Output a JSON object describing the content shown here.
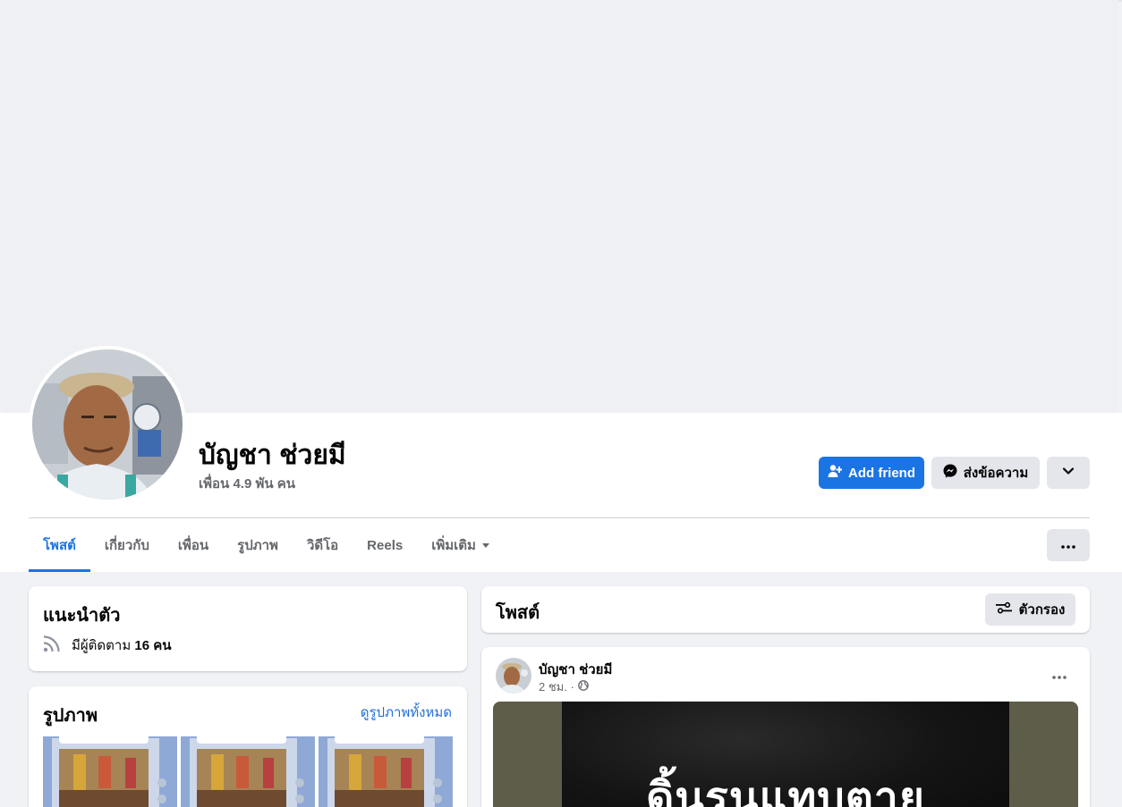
{
  "profile": {
    "name": "บัญชา ช่วยมี",
    "friends": "เพื่อน 4.9 พัน คน"
  },
  "actions": {
    "add_friend": "Add friend",
    "message": "ส่งข้อความ"
  },
  "tabs": [
    {
      "label": "โพสต์",
      "active": true
    },
    {
      "label": "เกี่ยวกับ",
      "active": false
    },
    {
      "label": "เพื่อน",
      "active": false
    },
    {
      "label": "รูปภาพ",
      "active": false
    },
    {
      "label": "วิดีโอ",
      "active": false
    },
    {
      "label": "Reels",
      "active": false
    },
    {
      "label": "เพิ่มเติม",
      "active": false
    }
  ],
  "intro": {
    "title": "แนะนำตัว",
    "followers_prefix": "มีผู้ติดตาม ",
    "followers_count": "16 คน"
  },
  "photos": {
    "title": "รูปภาพ",
    "see_all": "ดูรูปภาพทั้งหมด"
  },
  "posts": {
    "title": "โพสต์",
    "filter_label": "ตัวกรอง"
  },
  "post": {
    "author": "บัญชา ช่วยมี",
    "time": "2 ชม. ·",
    "media_caption": "ดิ้นรนแทบตาย"
  },
  "colors": {
    "accent": "#1b74e4",
    "link": "#216fdb",
    "secondary_button": "#e4e6eb",
    "page_background": "#f0f2f5"
  },
  "icons": {
    "add_friend": "person-plus-icon",
    "message": "messenger-icon",
    "dropdown": "chevron-down-icon",
    "more": "ellipsis-icon",
    "followers": "rss-icon",
    "filter": "sliders-icon",
    "privacy": "globe-icon"
  }
}
